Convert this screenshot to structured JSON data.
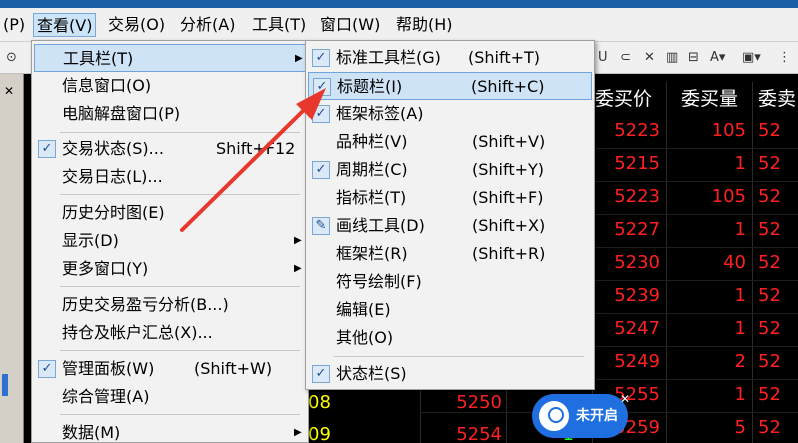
{
  "menubar": {
    "items": [
      {
        "label": "(P)"
      },
      {
        "label": "查看(V)"
      },
      {
        "label": "交易(O)"
      },
      {
        "label": "分析(A)"
      },
      {
        "label": "工具(T)"
      },
      {
        "label": "窗口(W)"
      },
      {
        "label": "帮助(H)"
      }
    ]
  },
  "view_menu": {
    "items": [
      {
        "label": "工具栏(T)",
        "submenu": true
      },
      {
        "label": "信息窗口(O)"
      },
      {
        "label": "电脑解盘窗口(P)"
      },
      {
        "label": "交易状态(S)...",
        "shortcut": "Shift+F12",
        "checked": true
      },
      {
        "label": "交易日志(L)..."
      },
      {
        "label": "历史分时图(E)"
      },
      {
        "label": "显示(D)",
        "submenu": true
      },
      {
        "label": "更多窗口(Y)",
        "submenu": true
      },
      {
        "label": "历史交易盈亏分析(B...)"
      },
      {
        "label": "持仓及帐户汇总(X)..."
      },
      {
        "label": "管理面板(W)",
        "shortcut": "(Shift+W)",
        "checked": true
      },
      {
        "label": "综合管理(A)"
      },
      {
        "label": "数据(M)",
        "submenu": true
      }
    ]
  },
  "toolbar_submenu": {
    "items": [
      {
        "label": "标准工具栏(G)",
        "shortcut": "(Shift+T)",
        "checked": true
      },
      {
        "label": "标题栏(I)",
        "shortcut": "(Shift+C)",
        "checked": true
      },
      {
        "label": "框架标签(A)",
        "checked": true
      },
      {
        "label": "品种栏(V)",
        "shortcut": "(Shift+V)"
      },
      {
        "label": "周期栏(C)",
        "shortcut": "(Shift+Y)",
        "checked": true
      },
      {
        "label": "指标栏(T)",
        "shortcut": "(Shift+F)"
      },
      {
        "label": "画线工具(D)",
        "shortcut": "(Shift+X)",
        "pen": true
      },
      {
        "label": "框架栏(R)",
        "shortcut": "(Shift+R)"
      },
      {
        "label": "符号绘制(F)"
      },
      {
        "label": "编辑(E)"
      },
      {
        "label": "其他(O)"
      },
      {
        "label": "状态栏(S)",
        "checked": true
      }
    ]
  },
  "quote_table": {
    "headers": [
      "委买价",
      "委买量",
      "委卖"
    ],
    "left_col": [
      "08",
      "09"
    ],
    "left_prices": [
      "5250",
      "5254"
    ],
    "rows": [
      {
        "bid": "5223",
        "vol": "105",
        "ask": "52"
      },
      {
        "bid": "5215",
        "vol": "1",
        "ask": "52"
      },
      {
        "bid": "5223",
        "vol": "105",
        "ask": "52"
      },
      {
        "bid": "5227",
        "vol": "1",
        "ask": "52"
      },
      {
        "bid": "5230",
        "vol": "40",
        "ask": "52"
      },
      {
        "bid": "5239",
        "vol": "1",
        "ask": "52"
      },
      {
        "bid": "5247",
        "vol": "1",
        "ask": "52"
      },
      {
        "bid": "5249",
        "vol": "2",
        "ask": "52"
      },
      {
        "bid": "5255",
        "vol": "1",
        "ask": "52"
      },
      {
        "bid": "5259",
        "vol": "5",
        "ask": "52"
      }
    ],
    "green_marks": [
      "1",
      "1"
    ]
  },
  "bubble": {
    "label": "未开启"
  },
  "colors": {
    "bid": "#ff2020",
    "volume": "#ff2020",
    "header": "#ffffff",
    "left_col": "#ffff00",
    "menu_highlight": "#cfe3f7",
    "arrow": "#e8382e"
  }
}
